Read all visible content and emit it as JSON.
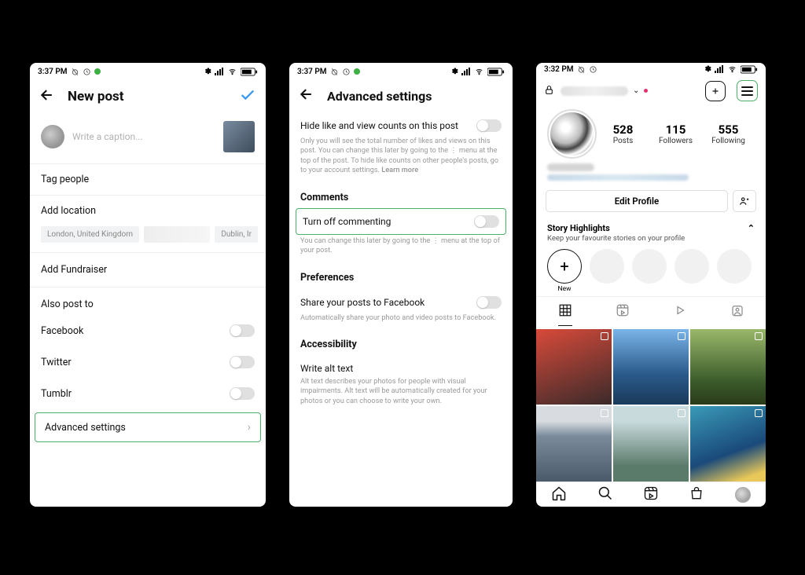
{
  "screen1": {
    "status_time": "3:37 PM",
    "header_title": "New post",
    "caption_placeholder": "Write a caption...",
    "tag_people": "Tag people",
    "add_location": "Add location",
    "location_suggestions": [
      "London, United Kingdom",
      "",
      "Dublin, Ir"
    ],
    "add_fundraiser": "Add Fundraiser",
    "also_post_label": "Also post to",
    "share_targets": [
      "Facebook",
      "Twitter",
      "Tumblr"
    ],
    "advanced_settings": "Advanced settings"
  },
  "screen2": {
    "status_time": "3:37 PM",
    "header_title": "Advanced settings",
    "hide_counts_label": "Hide like and view counts on this post",
    "hide_counts_desc": "Only you will see the total number of likes and views on this post. You can change this later by going to the ⋮ menu at the top of the post. To hide like counts on other people's posts, go to your account settings.",
    "learn_more": "Learn more",
    "comments_heading": "Comments",
    "turn_off_commenting": "Turn off commenting",
    "turn_off_commenting_desc": "You can change this later by going to the ⋮ menu at the top of your post.",
    "preferences_heading": "Preferences",
    "share_fb_label": "Share your posts to Facebook",
    "share_fb_desc": "Automatically share your photo and video posts to Facebook.",
    "accessibility_heading": "Accessibility",
    "alt_text_label": "Write alt text",
    "alt_text_desc": "Alt text describes your photos for people with visual impairments. Alt text will be automatically created for your photos or you can choose to write your own."
  },
  "screen3": {
    "status_time": "3:32 PM",
    "stats": {
      "posts": "528",
      "posts_label": "Posts",
      "followers": "115",
      "followers_label": "Followers",
      "following": "555",
      "following_label": "Following"
    },
    "edit_profile": "Edit Profile",
    "story_highlights": "Story Highlights",
    "story_sub": "Keep your favourite stories on your profile",
    "new_label": "New"
  }
}
